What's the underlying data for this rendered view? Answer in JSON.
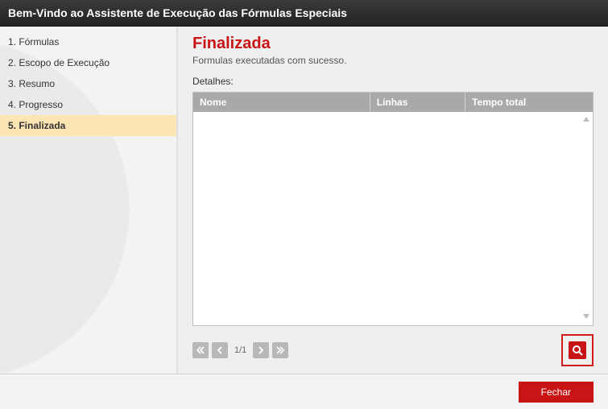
{
  "header": {
    "title": "Bem-Vindo ao Assistente de Execução das Fórmulas Especiais"
  },
  "sidebar": {
    "items": [
      {
        "label": "1. Fórmulas",
        "active": false
      },
      {
        "label": "2. Escopo de Execução",
        "active": false
      },
      {
        "label": "3. Resumo",
        "active": false
      },
      {
        "label": "4. Progresso",
        "active": false
      },
      {
        "label": "5. Finalizada",
        "active": true
      }
    ]
  },
  "main": {
    "title": "Finalizada",
    "subtitle": "Formulas executadas com sucesso.",
    "details_label": "Detalhes:",
    "columns": {
      "name": "Nome",
      "lines": "Linhas",
      "time": "Tempo total"
    },
    "rows": []
  },
  "pager": {
    "indicator": "1/1"
  },
  "footer": {
    "close_label": "Fechar"
  }
}
